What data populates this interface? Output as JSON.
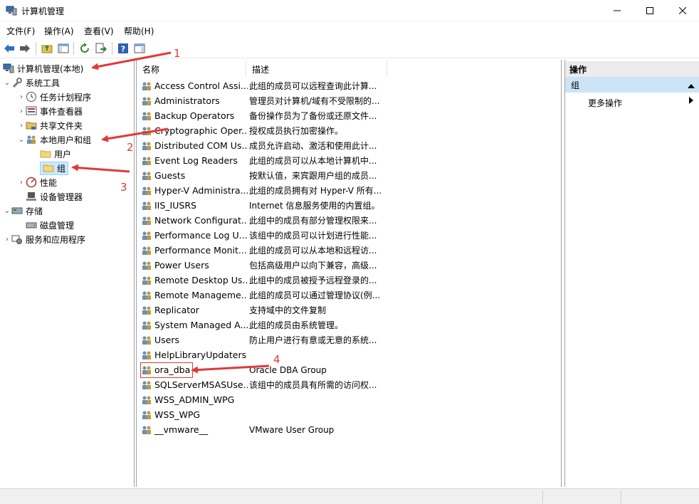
{
  "window": {
    "title": "计算机管理"
  },
  "menu": [
    "文件(F)",
    "操作(A)",
    "查看(V)",
    "帮助(H)"
  ],
  "tree": {
    "root": "计算机管理(本地)",
    "system_tools": "系统工具",
    "task_scheduler": "任务计划程序",
    "event_viewer": "事件查看器",
    "shared_folders": "共享文件夹",
    "local_users_groups": "本地用户和组",
    "users": "用户",
    "groups": "组",
    "performance": "性能",
    "device_manager": "设备管理器",
    "storage": "存储",
    "disk_management": "磁盘管理",
    "services_apps": "服务和应用程序"
  },
  "list": {
    "columns": [
      "名称",
      "描述"
    ],
    "rows": [
      {
        "name": "Access Control Assi...",
        "desc": "此组的成员可以远程查询此计算..."
      },
      {
        "name": "Administrators",
        "desc": "管理员对计算机/域有不受限制的..."
      },
      {
        "name": "Backup Operators",
        "desc": "备份操作员为了备份或还原文件..."
      },
      {
        "name": "Cryptographic Oper...",
        "desc": "授权成员执行加密操作。"
      },
      {
        "name": "Distributed COM Us...",
        "desc": "成员允许启动、激活和使用此计..."
      },
      {
        "name": "Event Log Readers",
        "desc": "此组的成员可以从本地计算机中..."
      },
      {
        "name": "Guests",
        "desc": "按默认值，来宾跟用户组的成员..."
      },
      {
        "name": "Hyper-V Administra...",
        "desc": "此组的成员拥有对 Hyper-V 所有..."
      },
      {
        "name": "IIS_IUSRS",
        "desc": "Internet 信息服务使用的内置组。"
      },
      {
        "name": "Network Configurat...",
        "desc": "此组中的成员有部分管理权限来..."
      },
      {
        "name": "Performance Log U...",
        "desc": "该组中的成员可以计划进行性能..."
      },
      {
        "name": "Performance Monit...",
        "desc": "此组的成员可以从本地和远程访..."
      },
      {
        "name": "Power Users",
        "desc": "包括高级用户以向下兼容，高级..."
      },
      {
        "name": "Remote Desktop Us...",
        "desc": "此组中的成员被授予远程登录的..."
      },
      {
        "name": "Remote Manageme...",
        "desc": "此组的成员可以通过管理协议(例..."
      },
      {
        "name": "Replicator",
        "desc": "支持域中的文件复制"
      },
      {
        "name": "System Managed A...",
        "desc": "此组的成员由系统管理。"
      },
      {
        "name": "Users",
        "desc": "防止用户进行有意或无意的系统..."
      },
      {
        "name": "HelpLibraryUpdaters",
        "desc": ""
      },
      {
        "name": "ora_dba",
        "desc": "Oracle DBA Group"
      },
      {
        "name": "SQLServerMSASUse...",
        "desc": "该组中的成员具有所需的访问权..."
      },
      {
        "name": "WSS_ADMIN_WPG",
        "desc": ""
      },
      {
        "name": "WSS_WPG",
        "desc": ""
      },
      {
        "name": "__vmware__",
        "desc": "VMware User Group"
      }
    ]
  },
  "actions": {
    "header": "操作",
    "group": "组",
    "more": "更多操作"
  },
  "annotations": [
    "1",
    "2",
    "3",
    "4"
  ],
  "colors": {
    "annotation_red": "#e03a3a",
    "selection_blue": "#cce8ff",
    "action_blue": "#cce4f7"
  }
}
